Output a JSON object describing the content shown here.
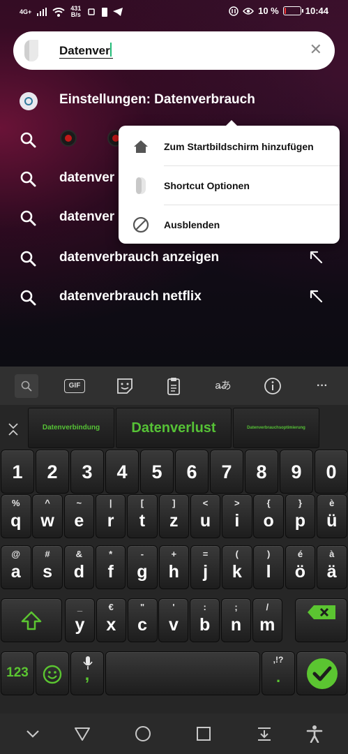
{
  "status_bar": {
    "network": "4G+",
    "speed_value": "431",
    "speed_unit": "B/s",
    "battery": "10 %",
    "battery_level": 0.1,
    "time": "10:44"
  },
  "search": {
    "query": "Datenver"
  },
  "results": [
    {
      "label": "Einstellungen: Datenverbrauch",
      "icon": "settings-icon"
    },
    {
      "label": "",
      "icon": "search-icon"
    },
    {
      "label": "datenver",
      "icon": "search-icon"
    },
    {
      "label": "datenver",
      "icon": "search-icon"
    },
    {
      "label": "datenverbrauch anzeigen",
      "icon": "search-icon"
    },
    {
      "label": "datenverbrauch netflix",
      "icon": "search-icon"
    }
  ],
  "popup_menu": {
    "items": [
      {
        "label": "Zum Startbildschirm hinzufügen",
        "icon": "home-icon"
      },
      {
        "label": "Shortcut Optionen",
        "icon": "app-logo-icon"
      },
      {
        "label": "Ausblenden",
        "icon": "block-icon"
      }
    ]
  },
  "keyboard": {
    "toolbar": {
      "gif": "GIF",
      "more": "···"
    },
    "suggestions": [
      "Datenverbindung",
      "Datenverlust",
      "Datenverbrauchsoptimierung"
    ],
    "number_row": [
      "1",
      "2",
      "3",
      "4",
      "5",
      "6",
      "7",
      "8",
      "9",
      "0"
    ],
    "row1": [
      {
        "sec": "%",
        "pri": "q"
      },
      {
        "sec": "^",
        "pri": "w"
      },
      {
        "sec": "~",
        "pri": "e"
      },
      {
        "sec": "|",
        "pri": "r"
      },
      {
        "sec": "[",
        "pri": "t"
      },
      {
        "sec": "]",
        "pri": "z"
      },
      {
        "sec": "<",
        "pri": "u"
      },
      {
        "sec": ">",
        "pri": "i"
      },
      {
        "sec": "{",
        "pri": "o"
      },
      {
        "sec": "}",
        "pri": "p"
      },
      {
        "sec": "è",
        "pri": "ü"
      }
    ],
    "row2": [
      {
        "sec": "@",
        "pri": "a"
      },
      {
        "sec": "#",
        "pri": "s"
      },
      {
        "sec": "&",
        "pri": "d"
      },
      {
        "sec": "*",
        "pri": "f"
      },
      {
        "sec": "-",
        "pri": "g"
      },
      {
        "sec": "+",
        "pri": "h"
      },
      {
        "sec": "=",
        "pri": "j"
      },
      {
        "sec": "(",
        "pri": "k"
      },
      {
        "sec": ")",
        "pri": "l"
      },
      {
        "sec": "é",
        "pri": "ö"
      },
      {
        "sec": "à",
        "pri": "ä"
      }
    ],
    "row3": [
      {
        "sec": "_",
        "pri": "y"
      },
      {
        "sec": "€",
        "pri": "x"
      },
      {
        "sec": "\"",
        "pri": "c"
      },
      {
        "sec": "'",
        "pri": "v"
      },
      {
        "sec": ":",
        "pri": "b"
      },
      {
        "sec": ";",
        "pri": "n"
      },
      {
        "sec": "/",
        "pri": "m"
      }
    ],
    "bottom": {
      "numbers": "123",
      "punct_sec": ",!?",
      "punct_pri": ".",
      "mic_sub": ","
    }
  },
  "colors": {
    "accent_green": "#5bc531",
    "battery_low": "#e33333",
    "popup_bg": "#ffffff"
  }
}
